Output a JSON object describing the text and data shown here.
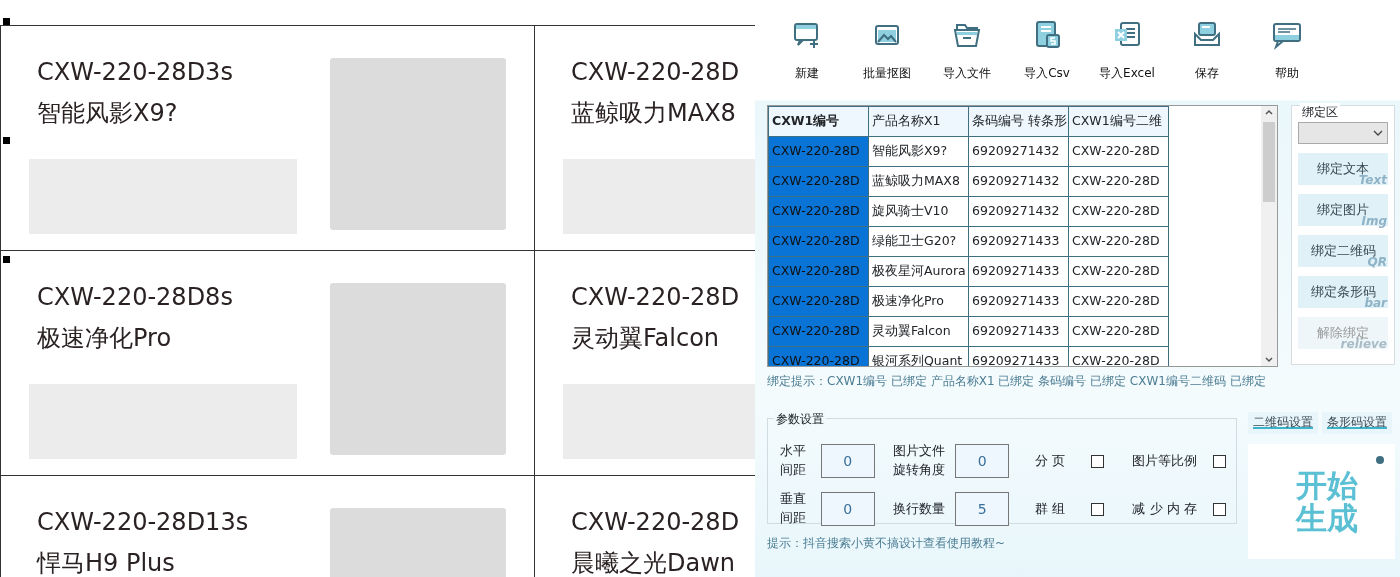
{
  "canvas": {
    "cards": [
      {
        "code": "CXW-220-28D3s",
        "name": "智能风影X9?"
      },
      {
        "code": "CXW-220-28D",
        "name": "蓝鲸吸力MAX8"
      },
      {
        "code": "CXW-220-28D8s",
        "name": "极速净化Pro"
      },
      {
        "code": "CXW-220-28D",
        "name": "灵动翼Falcon"
      },
      {
        "code": "CXW-220-28D13s",
        "name": "悍马H9 Plus"
      },
      {
        "code": "CXW-220-28D",
        "name": "晨曦之光Dawn"
      }
    ]
  },
  "toolbar": [
    {
      "kind": "new",
      "label": "新建"
    },
    {
      "kind": "picture",
      "label": "批量抠图"
    },
    {
      "kind": "folder",
      "label": "导入文件"
    },
    {
      "kind": "csv",
      "label": "导入Csv"
    },
    {
      "kind": "excel",
      "label": "导入Excel"
    },
    {
      "kind": "save",
      "label": "保存"
    },
    {
      "kind": "help",
      "label": "帮助"
    }
  ],
  "table": {
    "columns": [
      {
        "label": "CXW1编号",
        "selected": true
      },
      {
        "label": "产品名称X1",
        "selected": false
      },
      {
        "label": "条码编号 转条形",
        "selected": false
      },
      {
        "label": "CXW1编号二维",
        "selected": false
      }
    ],
    "rows": [
      [
        "CXW-220-28D",
        "智能风影X9?",
        "69209271432",
        "CXW-220-28D"
      ],
      [
        "CXW-220-28D",
        "蓝鲸吸力MAX8",
        "69209271432",
        "CXW-220-28D"
      ],
      [
        "CXW-220-28D",
        "旋风骑士V10",
        "69209271432",
        "CXW-220-28D"
      ],
      [
        "CXW-220-28D",
        "绿能卫士G20?",
        "69209271433",
        "CXW-220-28D"
      ],
      [
        "CXW-220-28D",
        "极夜星河Aurora",
        "69209271433",
        "CXW-220-28D"
      ],
      [
        "CXW-220-28D",
        "极速净化Pro",
        "69209271433",
        "CXW-220-28D"
      ],
      [
        "CXW-220-28D",
        "灵动翼Falcon",
        "69209271433",
        "CXW-220-28D"
      ],
      [
        "CXW-220-28D",
        "银河系列Quant",
        "69209271433",
        "CXW-220-28D"
      ]
    ]
  },
  "bind_panel": {
    "title": "绑定区",
    "buttons": [
      {
        "label": "绑定文本",
        "hint": "Text",
        "disabled": false
      },
      {
        "label": "绑定图片",
        "hint": "Img",
        "disabled": false
      },
      {
        "label": "绑定二维码",
        "hint": "QR",
        "disabled": false
      },
      {
        "label": "绑定条形码",
        "hint": "bar",
        "disabled": false
      },
      {
        "label": "解除绑定",
        "hint": "relieve",
        "disabled": true
      }
    ]
  },
  "bind_hint": "绑定提示：CXW1编号 已绑定  产品名称X1 已绑定  条码编号 已绑定  CXW1编号二维码 已绑定",
  "params": {
    "title": "参数设置",
    "fields": [
      {
        "label": "水平间距",
        "value": "0"
      },
      {
        "label": "图片文件旋转角度",
        "value": "0"
      },
      {
        "label": "垂直间距",
        "value": "0"
      },
      {
        "label": "换行数量",
        "value": "5"
      }
    ],
    "checkboxes": [
      {
        "label": "分 页",
        "checked": false
      },
      {
        "label": "图片等比例",
        "checked": false
      },
      {
        "label": "群 组",
        "checked": false
      },
      {
        "label": "减 少 内 存",
        "checked": false
      }
    ]
  },
  "setting_buttons": [
    "二维码设置",
    "条形码设置"
  ],
  "generate": "开始生成",
  "footer_hint": "提示：抖音搜索小黄不搞设计查看使用教程~"
}
